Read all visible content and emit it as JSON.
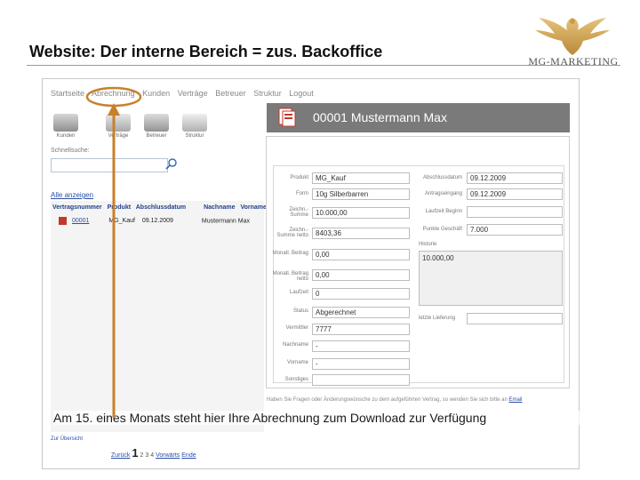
{
  "slide": {
    "title": "Website: Der interne Bereich = zus. Backoffice",
    "logo_text": "MG-MARKETING",
    "caption": "Am 15. eines Monats steht hier Ihre Abrechnung zum Download zur Verfügung"
  },
  "nav": {
    "items": [
      "Startseite",
      "Abrechnung",
      "Kunden",
      "Verträge",
      "Betreuer",
      "Struktur",
      "Logout"
    ]
  },
  "toolbar": {
    "items": [
      {
        "label": "Kunden"
      },
      {
        "label": "Verträge"
      },
      {
        "label": "Betreuer"
      },
      {
        "label": "Struktur"
      }
    ]
  },
  "search": {
    "label": "Schnellsuche:",
    "value": ""
  },
  "list": {
    "header": "Alle anzeigen",
    "columns": [
      "Vertragsnummer",
      "Produkt",
      "Abschlussdatum",
      "Nachname",
      "Vorname"
    ],
    "rows": [
      {
        "number": "00001",
        "product": "MG_Kauf",
        "date": "09.12.2009",
        "name": "Mustermann Max"
      }
    ]
  },
  "detail": {
    "title": "00001 Mustermann Max",
    "left_fields": [
      {
        "label": "Produkt",
        "value": "MG_Kauf"
      },
      {
        "label": "Form",
        "value": "10g Silberbarren"
      },
      {
        "label": "Zeichn.-Summe",
        "value": "10.000,00"
      },
      {
        "label": "Zeichn.-Summe netto",
        "value": "8403,36"
      },
      {
        "label": "Monatl. Beitrag",
        "value": "0,00"
      },
      {
        "label": "Monatl. Beitrag netto",
        "value": "0,00"
      },
      {
        "label": "Laufzeit",
        "value": "0"
      },
      {
        "label": "Status",
        "value": "Abgerechnet"
      },
      {
        "label": "Vermittler",
        "value": "7777"
      },
      {
        "label": "Nachname",
        "value": "-"
      },
      {
        "label": "Vorname",
        "value": "-"
      },
      {
        "label": "Sonstiges",
        "value": ""
      }
    ],
    "right_fields": [
      {
        "label": "Abschlussdatum",
        "value": "09.12.2009"
      },
      {
        "label": "Antragseingang",
        "value": "09.12.2009"
      },
      {
        "label": "Laufzeit Beginn",
        "value": ""
      },
      {
        "label": "Punkte Geschäft",
        "value": "7.000"
      }
    ],
    "history_label": "Historie",
    "history_value": "10.000,00",
    "delivery_label": "letzte Lieferung",
    "hint": "Haben Sie Fragen oder Änderungswünsche zu dem aufgeführten Vertrag, so wenden Sie sich bitte an",
    "hint_link": "Email"
  },
  "footer": {
    "link": "Zur Übersicht",
    "pager_prev": "Zurück",
    "pager_current": "1",
    "pager_pages": "2 3 4",
    "pager_next": "Vorwärts",
    "pager_end": "Ende"
  },
  "colors": {
    "highlight_ring": "#c8802a",
    "arrow": "#c8802a",
    "detail_header": "#7a7a7a"
  }
}
